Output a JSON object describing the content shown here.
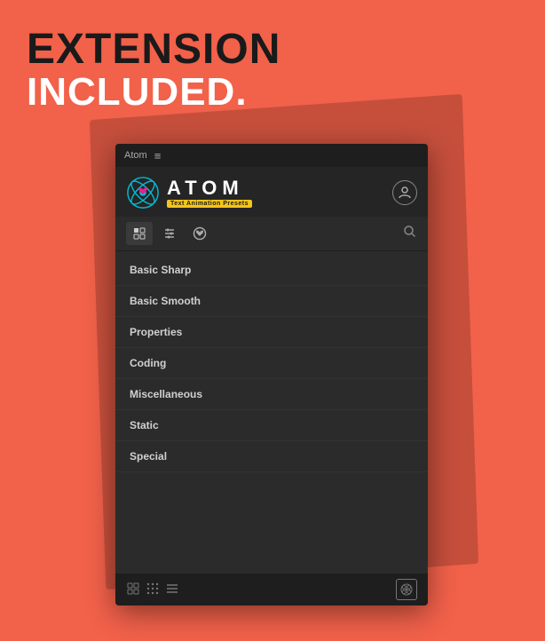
{
  "headline": {
    "line1": "EXTENSION",
    "line2": "INCLUDED."
  },
  "titlebar": {
    "app_name": "Atom",
    "menu_symbol": "≡"
  },
  "header": {
    "logo_letters": "ATOM",
    "subtitle": "Text Animation Presets"
  },
  "toolbar": {
    "btn1_icon": "presets-icon",
    "btn2_icon": "sliders-icon",
    "btn3_icon": "heart-icon",
    "search_icon": "search-icon"
  },
  "list": {
    "items": [
      {
        "label": "Basic Sharp"
      },
      {
        "label": "Basic Smooth"
      },
      {
        "label": "Properties"
      },
      {
        "label": "Coding"
      },
      {
        "label": "Miscellaneous"
      },
      {
        "label": "Static"
      },
      {
        "label": "Special"
      }
    ]
  },
  "bottombar": {
    "icon1": "grid-small-icon",
    "icon2": "grid-dots-icon",
    "icon3": "list-icon",
    "icon4": "atom-logo-small-icon"
  }
}
